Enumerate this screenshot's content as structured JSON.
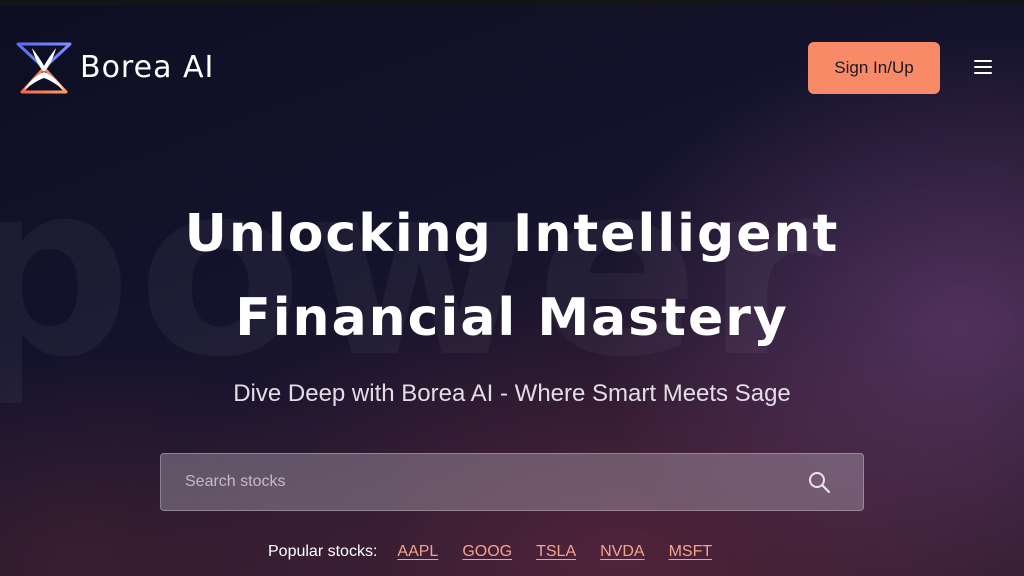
{
  "brand": {
    "name": "Borea AI",
    "logo_icon": "borea-logo-icon",
    "accent_color": "#f98a68"
  },
  "header": {
    "signin_label": "Sign In/Up",
    "menu_icon": "hamburger-menu-icon"
  },
  "hero": {
    "background_word": "power",
    "title_line1": "Unlocking Intelligent",
    "title_line2": "Financial Mastery",
    "subtitle": "Dive Deep with Borea AI - Where Smart Meets Sage"
  },
  "search": {
    "placeholder": "Search stocks",
    "value": "",
    "icon": "search-icon"
  },
  "popular": {
    "label": "Popular stocks:",
    "stocks": [
      "AAPL",
      "GOOG",
      "TSLA",
      "NVDA",
      "MSFT"
    ]
  }
}
